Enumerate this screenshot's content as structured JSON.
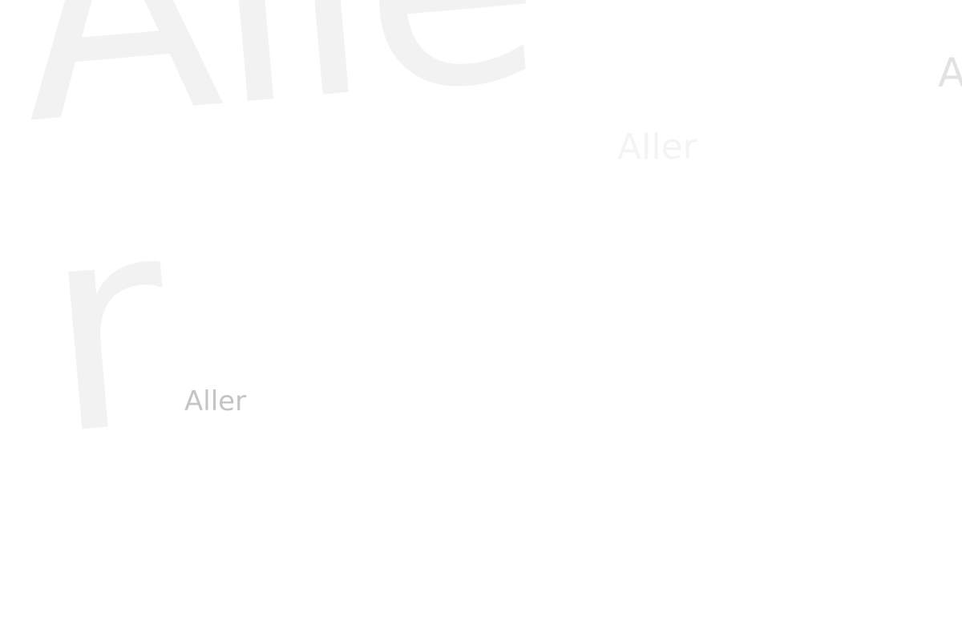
{
  "words": {
    "giant": "Aller",
    "faint": "Aller",
    "edge": "Aller",
    "small": "Aller"
  },
  "colors": {
    "background": "#ffffff",
    "giant_text": "#f2f2f2",
    "faint_text": "#f4f4f4",
    "edge_text": "#e2e2e2",
    "small_text": "#c4c4c4"
  }
}
